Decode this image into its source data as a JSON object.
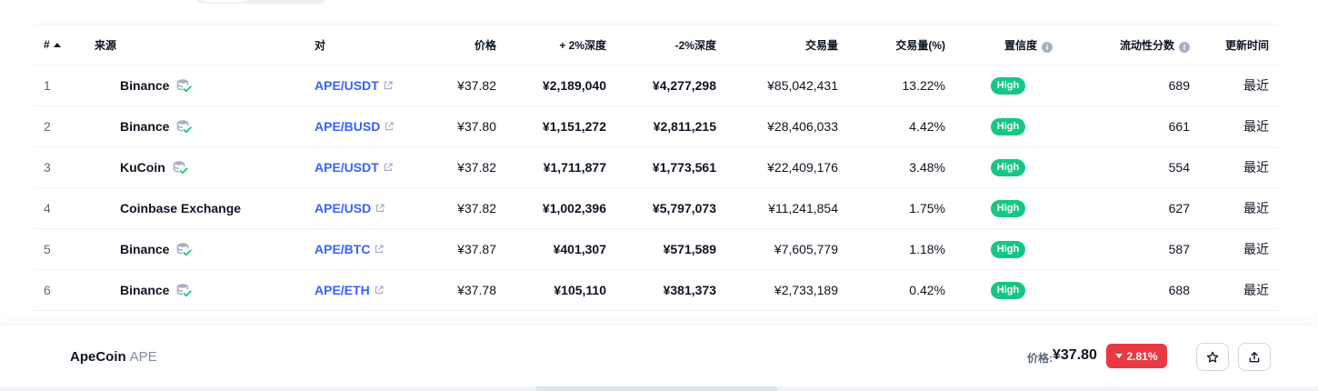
{
  "headers": {
    "rank": "#",
    "source": "来源",
    "pair": "对",
    "price": "价格",
    "depth_plus": "+ 2%深度",
    "depth_minus": "-2%深度",
    "volume": "交易量",
    "volume_pct": "交易量(%)",
    "confidence": "置信度",
    "liquidity": "流动性分数",
    "updated": "更新时间"
  },
  "rows": [
    {
      "rank": "1",
      "exchange": "Binance",
      "pair": "APE/USDT",
      "price": "¥37.82",
      "depth_plus": "¥2,189,040",
      "depth_minus": "¥4,277,298",
      "volume": "¥85,042,431",
      "volume_pct": "13.22%",
      "confidence": "High",
      "liquidity": "689",
      "updated": "最近"
    },
    {
      "rank": "2",
      "exchange": "Binance",
      "pair": "APE/BUSD",
      "price": "¥37.80",
      "depth_plus": "¥1,151,272",
      "depth_minus": "¥2,811,215",
      "volume": "¥28,406,033",
      "volume_pct": "4.42%",
      "confidence": "High",
      "liquidity": "661",
      "updated": "最近"
    },
    {
      "rank": "3",
      "exchange": "KuCoin",
      "pair": "APE/USDT",
      "price": "¥37.82",
      "depth_plus": "¥1,711,877",
      "depth_minus": "¥1,773,561",
      "volume": "¥22,409,176",
      "volume_pct": "3.48%",
      "confidence": "High",
      "liquidity": "554",
      "updated": "最近"
    },
    {
      "rank": "4",
      "exchange": "Coinbase Exchange",
      "pair": "APE/USD",
      "price": "¥37.82",
      "depth_plus": "¥1,002,396",
      "depth_minus": "¥5,797,073",
      "volume": "¥11,241,854",
      "volume_pct": "1.75%",
      "confidence": "High",
      "liquidity": "627",
      "updated": "最近"
    },
    {
      "rank": "5",
      "exchange": "Binance",
      "pair": "APE/BTC",
      "price": "¥37.87",
      "depth_plus": "¥401,307",
      "depth_minus": "¥571,589",
      "volume": "¥7,605,779",
      "volume_pct": "1.18%",
      "confidence": "High",
      "liquidity": "587",
      "updated": "最近"
    },
    {
      "rank": "6",
      "exchange": "Binance",
      "pair": "APE/ETH",
      "price": "¥37.78",
      "depth_plus": "¥105,110",
      "depth_minus": "¥381,373",
      "volume": "¥2,733,189",
      "volume_pct": "0.42%",
      "confidence": "High",
      "liquidity": "688",
      "updated": "最近"
    }
  ],
  "bottom_bar": {
    "coin_name": "ApeCoin",
    "coin_symbol": "APE",
    "price_label": "价格:",
    "price": "¥37.80",
    "change": "2.81%"
  },
  "icons": {
    "sort": "sort-ascending-icon",
    "info": "info-icon",
    "verified": "verified-database-icon",
    "external": "external-link-icon",
    "star": "star-icon",
    "share": "share-icon"
  },
  "colors": {
    "link": "#3861fb",
    "high_badge": "#16c784",
    "down": "#ea3943"
  }
}
